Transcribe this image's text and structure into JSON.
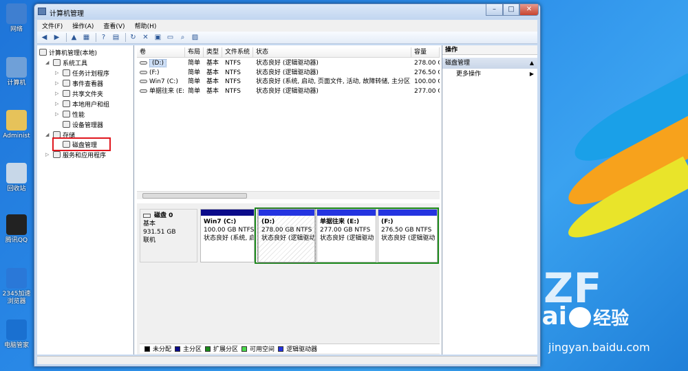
{
  "window": {
    "title": "计算机管理",
    "controls": [
      "–",
      "□",
      "✕"
    ]
  },
  "menu": [
    "文件(F)",
    "操作(A)",
    "查看(V)",
    "帮助(H)"
  ],
  "desktop_icons": [
    {
      "label": "网络",
      "color": "#3f7fd0"
    },
    {
      "label": "计算机",
      "color": "#6fa0d8"
    },
    {
      "label": "Administ",
      "color": "#e6c25a"
    },
    {
      "label": "回收站",
      "color": "#c7d7e8"
    },
    {
      "label": "腾讯QQ",
      "color": "#222222"
    },
    {
      "label": "2345加速浏览器",
      "color": "#2a78d8"
    },
    {
      "label": "电脑管家",
      "color": "#1a70d0"
    }
  ],
  "watermark": {
    "brand": "Bai",
    "brand2": "经验",
    "url": "jingyan.baidu.com",
    "zf": "ZF"
  },
  "tree": {
    "root": "计算机管理(本地)",
    "items": [
      {
        "label": "系统工具",
        "expanded": true
      },
      {
        "label": "任务计划程序"
      },
      {
        "label": "事件查看器"
      },
      {
        "label": "共享文件夹"
      },
      {
        "label": "本地用户和组"
      },
      {
        "label": "性能"
      },
      {
        "label": "设备管理器"
      },
      {
        "label": "存储",
        "expanded": true
      },
      {
        "label": "磁盘管理",
        "selected": true
      },
      {
        "label": "服务和应用程序"
      }
    ]
  },
  "volumes": {
    "headers": [
      "卷",
      "布局",
      "类型",
      "文件系统",
      "状态",
      "容量"
    ],
    "rows": [
      {
        "vol": "(D:)",
        "layout": "简单",
        "type": "基本",
        "fs": "NTFS",
        "status": "状态良好 (逻辑驱动器)",
        "cap": "278.00 G"
      },
      {
        "vol": "(F:)",
        "layout": "简单",
        "type": "基本",
        "fs": "NTFS",
        "status": "状态良好 (逻辑驱动器)",
        "cap": "276.50 G"
      },
      {
        "vol": "Win7 (C:)",
        "layout": "简单",
        "type": "基本",
        "fs": "NTFS",
        "status": "状态良好 (系统, 启动, 页面文件, 活动, 故障转储, 主分区)",
        "cap": "100.00 G"
      },
      {
        "vol": "单据往来 (E:)",
        "layout": "简单",
        "type": "基本",
        "fs": "NTFS",
        "status": "状态良好 (逻辑驱动器)",
        "cap": "277.00 G"
      }
    ]
  },
  "disk": {
    "name": "磁盘 0",
    "type": "基本",
    "size": "931.51 GB",
    "state": "联机"
  },
  "partitions": [
    {
      "title": "Win7 (C:)",
      "size": "100.00 GB NTFS",
      "status": "状态良好 (系统, 启",
      "bar": "#0b0b8a"
    },
    {
      "title": "(D:)",
      "size": "278.00 GB NTFS",
      "status": "状态良好 (逻辑驱动",
      "bar": "#2434e0"
    },
    {
      "title": "单据往来  (E:)",
      "size": "277.00 GB NTFS",
      "status": "状态良好 (逻辑驱动",
      "bar": "#2434e0"
    },
    {
      "title": "(F:)",
      "size": "276.50 GB NTFS",
      "status": "状态良好 (逻辑驱动",
      "bar": "#2434e0"
    }
  ],
  "legend": [
    {
      "label": "未分配",
      "color": "#000000"
    },
    {
      "label": "主分区",
      "color": "#0b0b8a"
    },
    {
      "label": "扩展分区",
      "color": "#1c8a1c"
    },
    {
      "label": "可用空间",
      "color": "#4cd94c"
    },
    {
      "label": "逻辑驱动器",
      "color": "#2434e0"
    }
  ],
  "actions": {
    "header": "操作",
    "section": "磁盘管理",
    "item": "更多操作"
  }
}
